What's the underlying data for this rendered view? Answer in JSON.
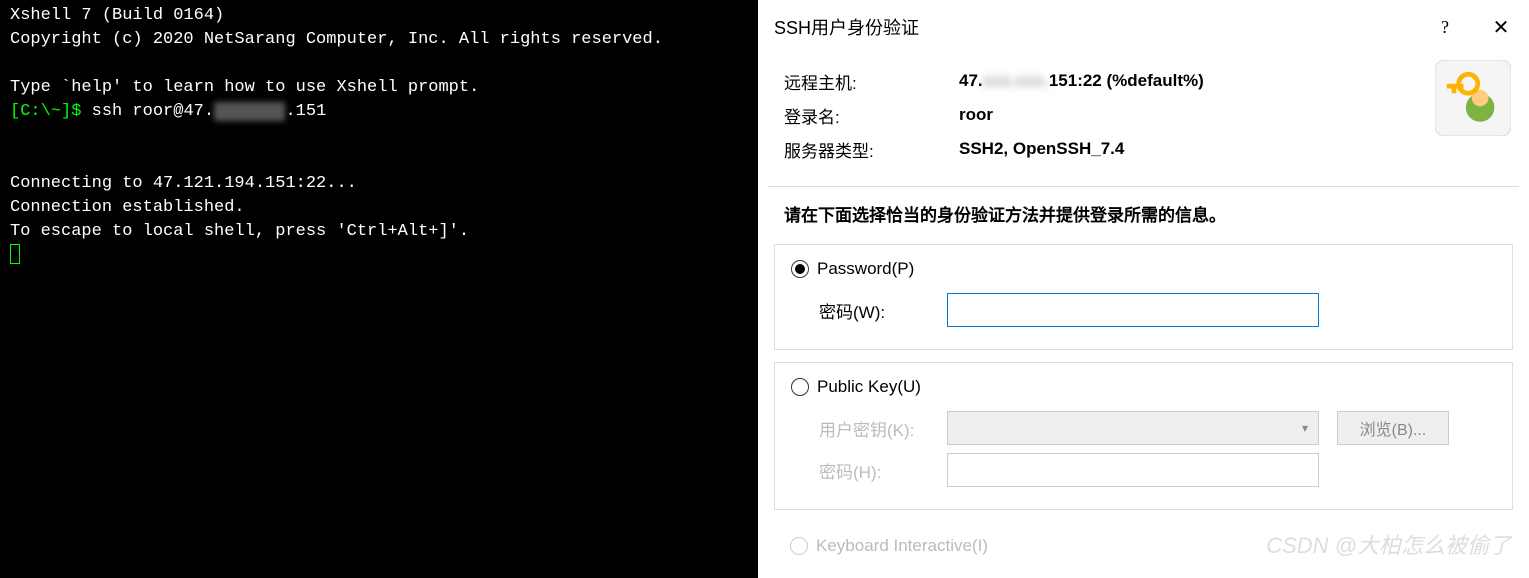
{
  "terminal": {
    "line1": "Xshell 7 (Build 0164)",
    "line2": "Copyright (c) 2020 NetSarang Computer, Inc. All rights reserved.",
    "line3": "",
    "line4": "Type `help' to learn how to use Xshell prompt.",
    "prompt": "[C:\\~]$ ",
    "cmd_a": "ssh roor@47.",
    "cmd_blur": "xxx.xxx",
    "cmd_b": ".151",
    "line6": "",
    "line7": "",
    "line8": "Connecting to 47.121.194.151:22...",
    "line9": "Connection established.",
    "line10": "To escape to local shell, press 'Ctrl+Alt+]'."
  },
  "dialog": {
    "title": "SSH用户身份验证",
    "help": "?",
    "close": "✕",
    "host_label": "远程主机:",
    "host_value_a": "47.",
    "host_value_blur": "xxx.xxx.",
    "host_value_b": "151:22 (%default%)",
    "login_label": "登录名:",
    "login_value": "roor",
    "server_label": "服务器类型:",
    "server_value": "SSH2, OpenSSH_7.4",
    "instruction": "请在下面选择恰当的身份验证方法并提供登录所需的信息。",
    "password_radio": "Password(P)",
    "password_label": "密码(W):",
    "publickey_radio": "Public Key(U)",
    "userkey_label": "用户密钥(K):",
    "browse_btn": "浏览(B)...",
    "pk_password_label": "密码(H):",
    "keyboard_radio": "Keyboard Interactive(I)"
  },
  "watermark": "CSDN @大柏怎么被偷了"
}
